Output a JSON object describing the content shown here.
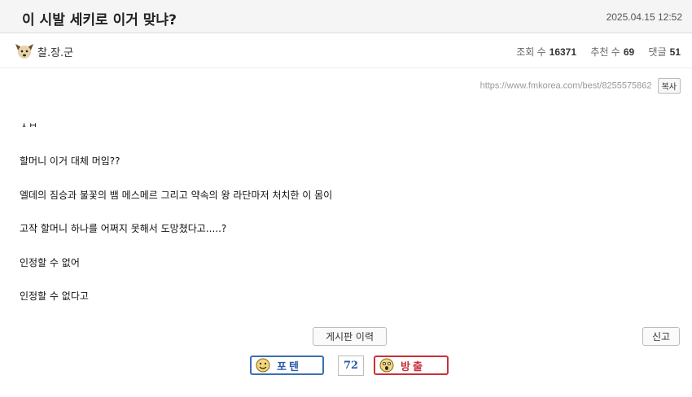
{
  "post": {
    "title": "이 시발 세키로 이거 맞냐?",
    "date": "2025.04.15 12:52",
    "author": "찰.장.군",
    "author_avatar_icon": "dog-face-icon",
    "stats": {
      "views_label": "조회 수",
      "views": "16371",
      "recommend_label": "추천 수",
      "recommend": "69",
      "comments_label": "댓글",
      "comments": "51"
    },
    "url": "https://www.fmkorea.com/best/8255575862",
    "copy_label": "복사"
  },
  "content": {
    "clipped_line": "ㅅㅂ",
    "lines": [
      "할머니 이거 대체 머임??",
      "엘데의 짐승과 불꽃의 뱀 메스메르 그리고 약속의 왕 라단마저 처치한 이 몸이",
      "고작 할머니 하나를 어쩌지 못해서 도망쳤다고.....?",
      "인정할 수 없어",
      "인정할 수 없다고"
    ]
  },
  "actions": {
    "history_label": "게시판 이력",
    "report_label": "신고",
    "upvote_label": "포텐",
    "upvote_icon": "happy-face-icon",
    "vote_count": "72",
    "downvote_label": "방출",
    "downvote_icon": "scared-face-icon",
    "colors": {
      "upvote": "#3a6fb5",
      "downvote": "#c9303a"
    }
  }
}
